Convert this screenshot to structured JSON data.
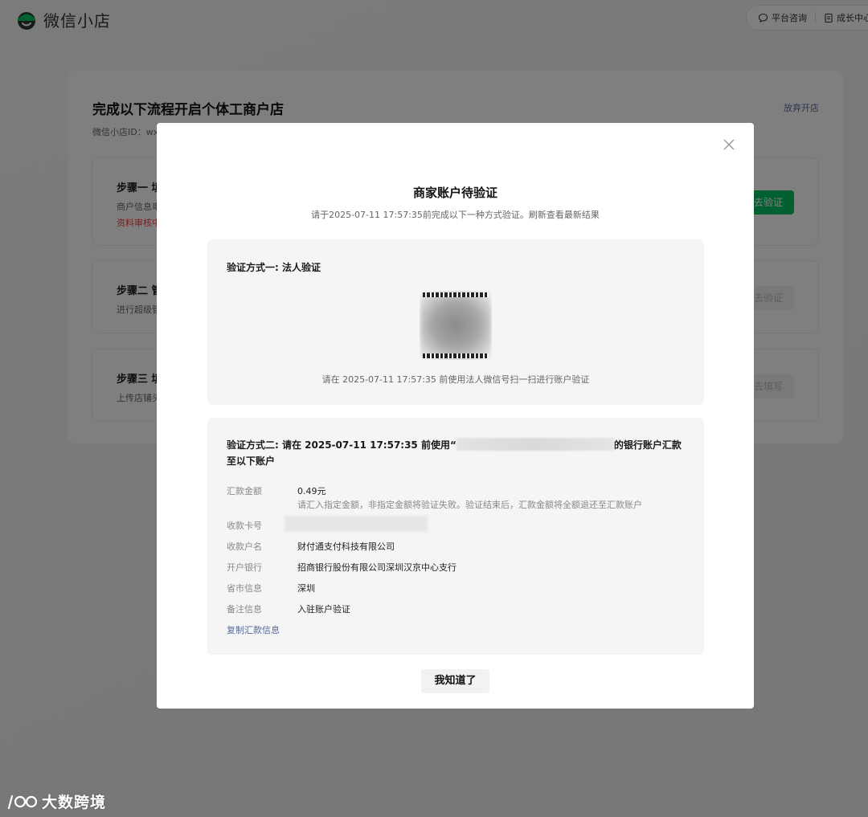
{
  "header": {
    "app_name": "微信小店",
    "actions": [
      {
        "label": "平台咨询",
        "icon": "chat-bubble-icon"
      },
      {
        "label": "成长中心",
        "icon": "document-icon"
      }
    ]
  },
  "background": {
    "title": "完成以下流程开启个体工商户店",
    "shop_id_label": "微信小店ID：wx",
    "abandon_label": "放弃开店",
    "steps": [
      {
        "title": "步骤一 填",
        "desc": "商户信息审",
        "status": "资料审核中",
        "button": "去验证"
      },
      {
        "title": "步骤二 管",
        "desc": "进行超级管",
        "button": "去验证"
      },
      {
        "title": "步骤三 填",
        "desc": "上传店铺头",
        "button": "去填写"
      }
    ]
  },
  "modal": {
    "title": "商家账户待验证",
    "subtitle": "请于2025-07-11 17:57:35前完成以下一种方式验证。刷新查看最新结果",
    "method1": {
      "title": "验证方式一: 法人验证",
      "hint": "请在 2025-07-11 17:57:35 前使用法人微信号扫一扫进行账户验证"
    },
    "method2": {
      "title_prefix": "验证方式二: 请在 2025-07-11 17:57:35 前使用“",
      "title_suffix": "的银行账户汇款至以下账户",
      "rows": {
        "amount": {
          "label": "汇款金额",
          "value": "0.49元",
          "note": "请汇入指定金额，非指定金额将验证失败。验证结束后，汇款金额将全额退还至汇款账户"
        },
        "card": {
          "label": "收款卡号"
        },
        "name": {
          "label": "收款户名",
          "value": "财付通支付科技有限公司"
        },
        "bank": {
          "label": "开户银行",
          "value": "招商银行股份有限公司深圳汉京中心支行"
        },
        "region": {
          "label": "省市信息",
          "value": "深圳"
        },
        "remark": {
          "label": "备注信息",
          "value": "入驻账户验证"
        }
      },
      "copy_label": "复制汇款信息"
    },
    "ok_button": "我知道了"
  },
  "watermark": {
    "text": "大数跨境"
  },
  "colors": {
    "brand_green": "#07c160",
    "link_blue": "#576b95",
    "warn_red": "#e54545"
  }
}
